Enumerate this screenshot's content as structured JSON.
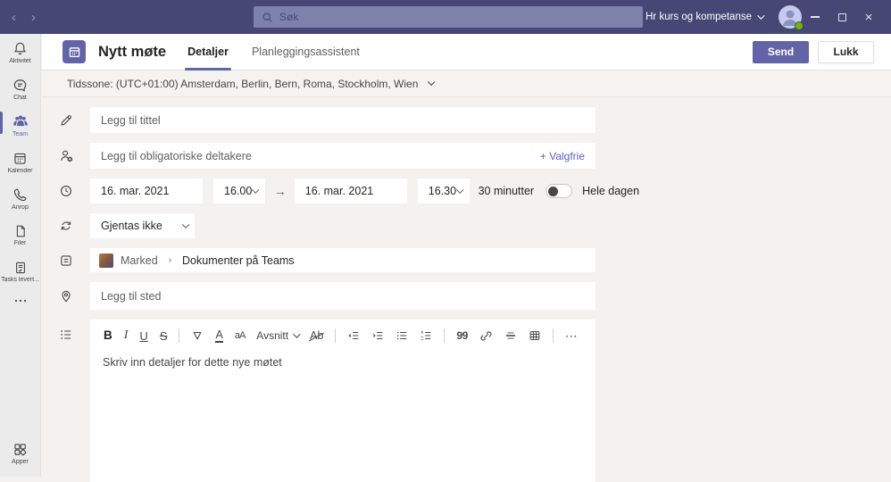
{
  "colors": {
    "accent": "#6264A7",
    "topbar": "#464775",
    "presence": "#6BB700"
  },
  "topbar": {
    "search_placeholder": "Søk",
    "org_name": "Hr kurs og kompetanse"
  },
  "sidebar": {
    "items": [
      {
        "label": "Aktivitet",
        "icon": "bell"
      },
      {
        "label": "Chat",
        "icon": "chat-bubble"
      },
      {
        "label": "Team",
        "icon": "people",
        "active": true
      },
      {
        "label": "Kalender",
        "icon": "calendar"
      },
      {
        "label": "Anrop",
        "icon": "phone"
      },
      {
        "label": "Filer",
        "icon": "file"
      },
      {
        "label": "Tasks levert...",
        "icon": "tasks"
      }
    ],
    "apps_label": "Apper"
  },
  "header": {
    "title": "Nytt møte",
    "tab_details": "Detaljer",
    "tab_scheduling": "Planleggingsassistent",
    "send_label": "Send",
    "close_label": "Lukk"
  },
  "timezone_label": "Tidssone: (UTC+01:00) Amsterdam, Berlin, Bern, Roma, Stockholm, Wien",
  "form": {
    "title_placeholder": "Legg til tittel",
    "attendees_placeholder": "Legg til obligatoriske deltakere",
    "optional_label": "+ Valgfrie",
    "start_date": "16. mar. 2021",
    "start_time": "16.00",
    "end_date": "16. mar. 2021",
    "end_time": "16.30",
    "duration_label": "30 minutter",
    "all_day_label": "Hele dagen",
    "repeat_value": "Gjentas ikke",
    "channel_team": "Marked",
    "channel_name": "Dokumenter på Teams",
    "location_placeholder": "Legg til sted"
  },
  "editor": {
    "placeholder": "Skriv inn detaljer for dette nye møtet",
    "toolbar": {
      "bold": "B",
      "italic": "I",
      "underline": "U",
      "strikethrough": "S",
      "font_color": "A",
      "font_size": "aA",
      "paragraph": "Avsnitt",
      "clear_format": "Ab",
      "quote": "99",
      "more": "⋯"
    }
  }
}
